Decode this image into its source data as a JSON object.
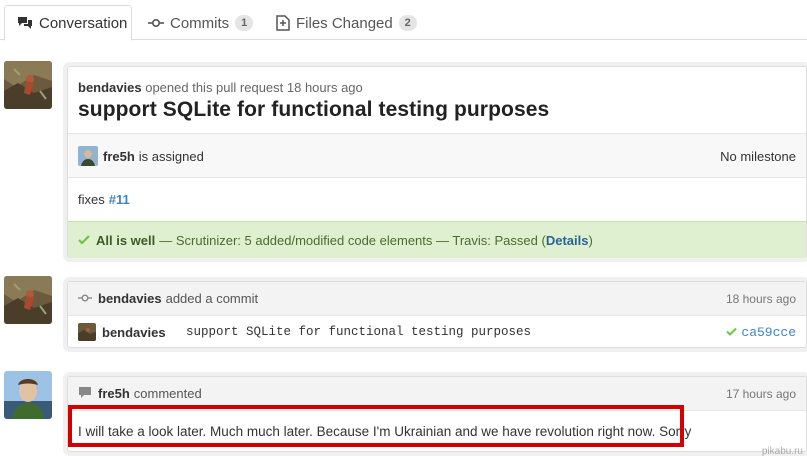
{
  "tabs": [
    {
      "label": "Conversation",
      "icon": "conversation-icon",
      "selected": true
    },
    {
      "label": "Commits",
      "icon": "commit-icon",
      "count": "1"
    },
    {
      "label": "Files Changed",
      "icon": "file-diff-icon",
      "count": "2"
    }
  ],
  "pull_request": {
    "author": "bendavies",
    "opened_text": "opened this pull request 18 hours ago",
    "title": "support SQLite for functional testing purposes",
    "assignee": "fre5h",
    "assigned_text": "is assigned",
    "milestone": "No milestone",
    "body_text": "fixes",
    "body_link": "#11",
    "status_ok": "All is well",
    "status_desc": "— Scrutinizer: 5 added/modified code elements — Travis: Passed (",
    "status_link": "Details",
    "status_close": ")"
  },
  "commit_event": {
    "author": "bendavies",
    "action": "added a commit",
    "time": "18 hours ago",
    "commit_author": "bendavies",
    "commit_message": "support SQLite for functional testing purposes",
    "sha": "ca59cce"
  },
  "comment": {
    "author": "fre5h",
    "action": "commented",
    "time": "17 hours ago",
    "text": "I will take a look later. Much much later. Because I'm Ukrainian and we have revolution right now. Sorry"
  },
  "watermark": "pikabu.ru",
  "colors": {
    "link": "#4183c4",
    "status_bg": "#dff0d0",
    "highlight": "#d40000",
    "success_check": "#6cc644"
  }
}
